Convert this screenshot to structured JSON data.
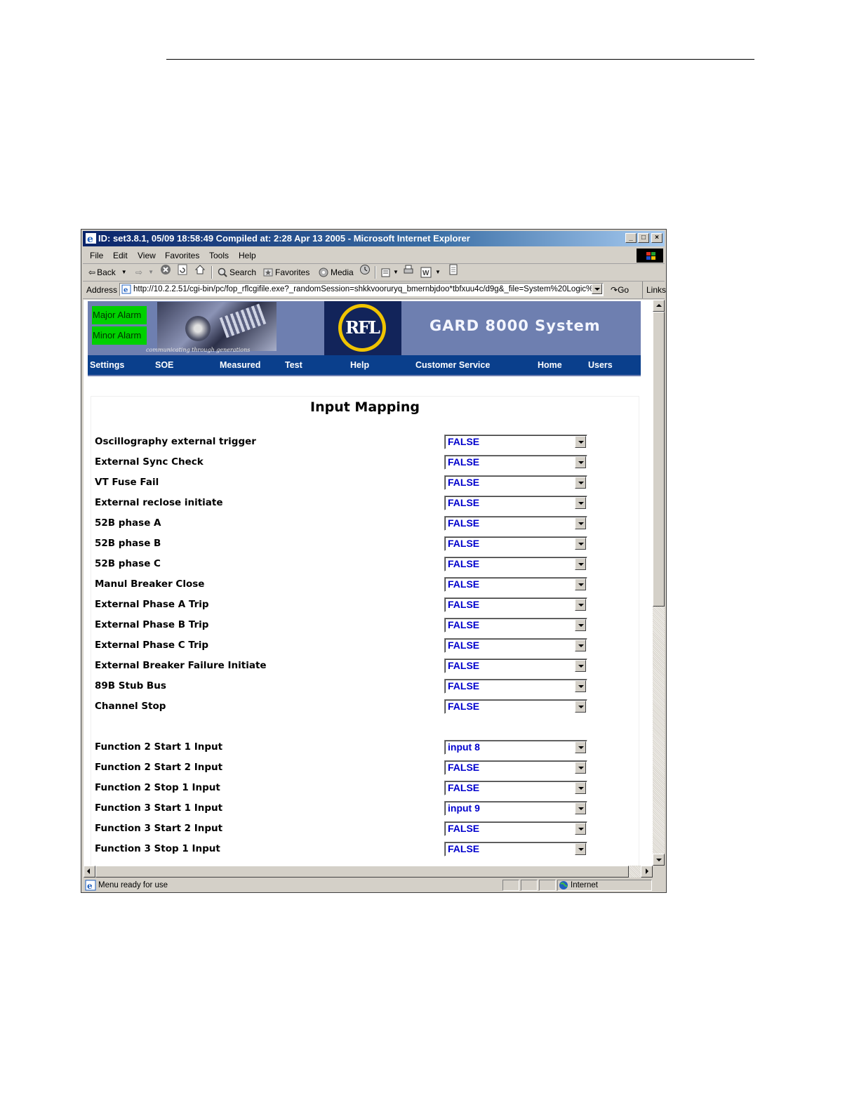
{
  "window": {
    "title": "ID: set3.8.1, 05/09 18:58:49 Compiled at: 2:28 Apr 13 2005 - Microsoft Internet Explorer",
    "controls": [
      "_",
      "□",
      "×"
    ]
  },
  "menu": [
    "File",
    "Edit",
    "View",
    "Favorites",
    "Tools",
    "Help"
  ],
  "toolbar": {
    "back": "Back",
    "search": "Search",
    "favorites": "Favorites",
    "media": "Media"
  },
  "address": {
    "label": "Address",
    "url": "http://10.2.2.51/cgi-bin/pc/fop_rflcgifile.exe?_randomSession=shkkvooruryq_bmernbjdoo*tbfxuu4c/d9g&_file=System%20Logic%",
    "go": "Go",
    "links": "Links"
  },
  "banner": {
    "major_alarm": "Major Alarm",
    "minor_alarm": "Minor Alarm",
    "tagline": "communicating through generations",
    "logo_text": "RFL",
    "system_title": "GARD 8000 System"
  },
  "nav": [
    "Settings",
    "SOE",
    "Measured",
    "Test",
    "Help",
    "Customer Service",
    "Home",
    "Users"
  ],
  "page": {
    "heading": "Input Mapping",
    "rows": [
      {
        "label": "Oscillography external trigger",
        "value": "FALSE"
      },
      {
        "label": "External Sync Check",
        "value": "FALSE"
      },
      {
        "label": "VT Fuse Fail",
        "value": "FALSE"
      },
      {
        "label": "External reclose initiate",
        "value": "FALSE"
      },
      {
        "label": "52B phase A",
        "value": "FALSE"
      },
      {
        "label": "52B phase B",
        "value": "FALSE"
      },
      {
        "label": "52B phase C",
        "value": "FALSE"
      },
      {
        "label": "Manul Breaker Close",
        "value": "FALSE"
      },
      {
        "label": "External Phase A Trip",
        "value": "FALSE"
      },
      {
        "label": "External Phase B Trip",
        "value": "FALSE"
      },
      {
        "label": "External Phase C Trip",
        "value": "FALSE"
      },
      {
        "label": "External Breaker Failure Initiate",
        "value": "FALSE"
      },
      {
        "label": "89B Stub Bus",
        "value": "FALSE"
      },
      {
        "label": "Channel Stop",
        "value": "FALSE"
      },
      {
        "label": "Function 2 Start 1 Input",
        "value": "input 8"
      },
      {
        "label": "Function 2 Start 2 Input",
        "value": "FALSE"
      },
      {
        "label": "Function 2 Stop 1 Input",
        "value": "FALSE"
      },
      {
        "label": "Function 3 Start 1 Input",
        "value": "input 9"
      },
      {
        "label": "Function 3 Start 2 Input",
        "value": "FALSE"
      },
      {
        "label": "Function 3 Stop 1 Input",
        "value": "FALSE"
      }
    ]
  },
  "status": {
    "text": "Menu ready for use",
    "zone": "Internet"
  },
  "colors": {
    "titlebar": "#0a246a",
    "banner": "#6e7fb0",
    "navbar": "#0a3f8c",
    "alarm_green": "#00d000",
    "select_value": "#0000cc"
  }
}
